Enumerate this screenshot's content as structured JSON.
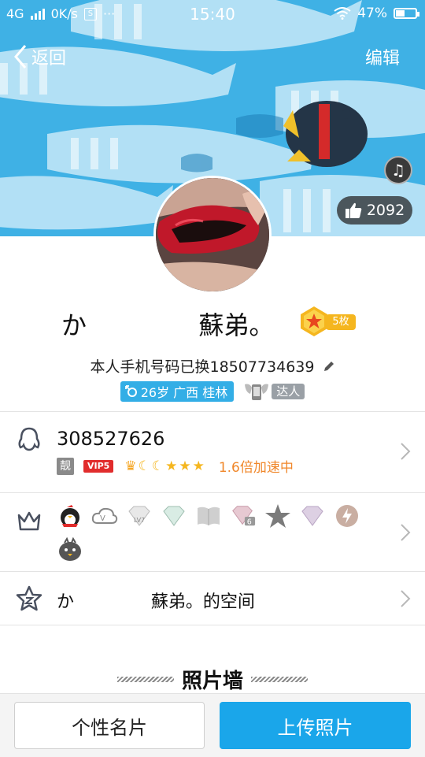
{
  "status_bar": {
    "network": "4G",
    "speed": "0K/s",
    "dots": "···",
    "time": "15:40",
    "battery_percent": "47%",
    "battery_level": 0.47
  },
  "nav": {
    "back_label": "返回",
    "edit_label": "编辑"
  },
  "cover": {
    "likes_count": "2092"
  },
  "profile": {
    "name": "か              蘇弟。",
    "badge_count": "5枚",
    "signature": "本人手机号码已换18507734639",
    "info_tag": "26岁 广西 桂林",
    "daren_tag": "达人"
  },
  "qq_row": {
    "number": "308527626",
    "liang_label": "靓",
    "vip_label": "VIP5",
    "speed_text": "1.6倍加速中"
  },
  "space_row": {
    "label": "か              蘇弟。的空间"
  },
  "photo_wall": {
    "title": "照片墙"
  },
  "bottom": {
    "card_label": "个性名片",
    "upload_label": "上传照片"
  },
  "colors": {
    "accent": "#1aa6ea",
    "speed_text": "#f0872a",
    "vip_red": "#e12c2c",
    "badge_gold": "#f5b61f"
  }
}
